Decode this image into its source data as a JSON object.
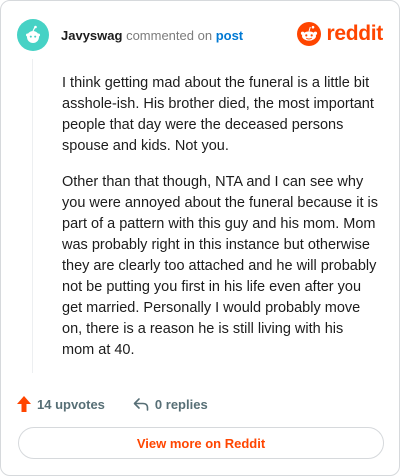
{
  "comment": {
    "username": "Javyswag",
    "action_text": "commented on",
    "post_link": "post",
    "paragraphs": [
      "I think getting mad about the funeral is a little bit asshole-ish. His brother died, the most important people that day were the deceased persons spouse and kids. Not you.",
      "Other than that though, NTA and I can see why you were annoyed about the funeral because it is part of a pattern with this guy and his mom. Mom was probably right in this instance but otherwise they are clearly too attached and he will probably not be putting you first in his life even after you get married. Personally I would probably move on, there is a reason he is still living with his mom at 40."
    ]
  },
  "brand": {
    "logo_text": "reddit",
    "color": "#ff4500"
  },
  "actions": {
    "upvotes_label": "14 upvotes",
    "replies_label": "0 replies",
    "upvote_icon": "upvote-arrow-icon",
    "reply_icon": "reply-arrow-icon"
  },
  "footer": {
    "view_more_label": "View more on Reddit"
  },
  "colors": {
    "accent": "#ff4500",
    "link": "#0079d3",
    "avatar": "#46d2c5",
    "muted": "#576f76"
  }
}
